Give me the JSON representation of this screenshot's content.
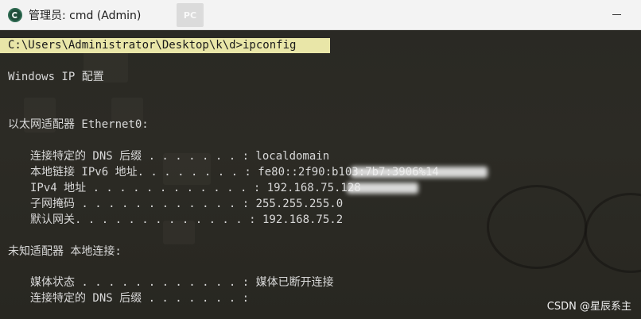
{
  "window": {
    "title": "管理员: cmd (Admin)",
    "background_ghost": "PC"
  },
  "console": {
    "prompt_line": "C:\\Users\\Administrator\\Desktop\\k\\d>ipconfig",
    "lines": [
      "Windows IP 配置",
      "以太网适配器 Ethernet0:",
      "连接特定的 DNS 后缀 . . . . . . . : localdomain",
      "本地链接 IPv6 地址. . . . . . . . : fe80::2f90:b103:7b7:3906%14",
      "IPv4 地址 . . . . . . . . . . . . : 192.168.75.128",
      "子网掩码 . . . . . . . . . . . . : 255.255.255.0",
      "默认网关. . . . . . . . . . . . . : 192.168.75.2",
      "未知适配器 本地连接:",
      "媒体状态 . . . . . . . . . . . . : 媒体已断开连接",
      "连接特定的 DNS 后缀 . . . . . . . :"
    ]
  },
  "watermark": "CSDN @星辰系主",
  "colors": {
    "console_bg": "#2b2a25",
    "console_text": "#d8d8d8",
    "selection_bg": "#e9e6a8",
    "titlebar_bg": "#f3f3f3"
  }
}
